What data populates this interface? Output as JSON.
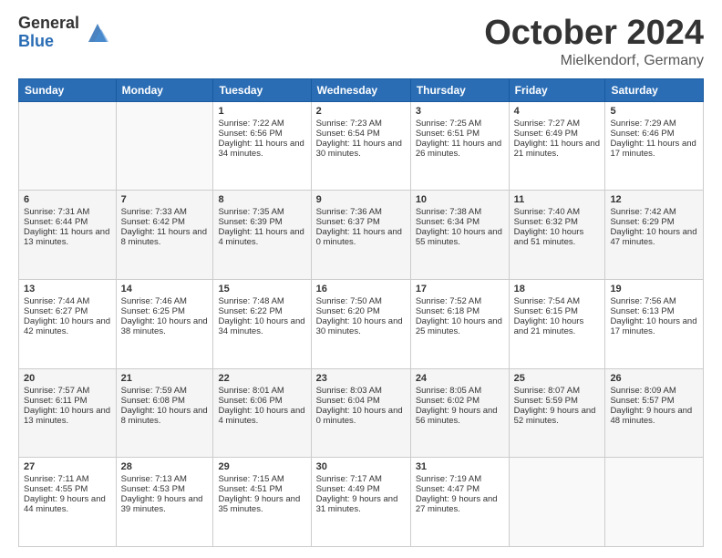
{
  "logo": {
    "general": "General",
    "blue": "Blue"
  },
  "header": {
    "month": "October 2024",
    "location": "Mielkendorf, Germany"
  },
  "weekdays": [
    "Sunday",
    "Monday",
    "Tuesday",
    "Wednesday",
    "Thursday",
    "Friday",
    "Saturday"
  ],
  "weeks": [
    [
      {
        "day": "",
        "sunrise": "",
        "sunset": "",
        "daylight": ""
      },
      {
        "day": "",
        "sunrise": "",
        "sunset": "",
        "daylight": ""
      },
      {
        "day": "1",
        "sunrise": "Sunrise: 7:22 AM",
        "sunset": "Sunset: 6:56 PM",
        "daylight": "Daylight: 11 hours and 34 minutes."
      },
      {
        "day": "2",
        "sunrise": "Sunrise: 7:23 AM",
        "sunset": "Sunset: 6:54 PM",
        "daylight": "Daylight: 11 hours and 30 minutes."
      },
      {
        "day": "3",
        "sunrise": "Sunrise: 7:25 AM",
        "sunset": "Sunset: 6:51 PM",
        "daylight": "Daylight: 11 hours and 26 minutes."
      },
      {
        "day": "4",
        "sunrise": "Sunrise: 7:27 AM",
        "sunset": "Sunset: 6:49 PM",
        "daylight": "Daylight: 11 hours and 21 minutes."
      },
      {
        "day": "5",
        "sunrise": "Sunrise: 7:29 AM",
        "sunset": "Sunset: 6:46 PM",
        "daylight": "Daylight: 11 hours and 17 minutes."
      }
    ],
    [
      {
        "day": "6",
        "sunrise": "Sunrise: 7:31 AM",
        "sunset": "Sunset: 6:44 PM",
        "daylight": "Daylight: 11 hours and 13 minutes."
      },
      {
        "day": "7",
        "sunrise": "Sunrise: 7:33 AM",
        "sunset": "Sunset: 6:42 PM",
        "daylight": "Daylight: 11 hours and 8 minutes."
      },
      {
        "day": "8",
        "sunrise": "Sunrise: 7:35 AM",
        "sunset": "Sunset: 6:39 PM",
        "daylight": "Daylight: 11 hours and 4 minutes."
      },
      {
        "day": "9",
        "sunrise": "Sunrise: 7:36 AM",
        "sunset": "Sunset: 6:37 PM",
        "daylight": "Daylight: 11 hours and 0 minutes."
      },
      {
        "day": "10",
        "sunrise": "Sunrise: 7:38 AM",
        "sunset": "Sunset: 6:34 PM",
        "daylight": "Daylight: 10 hours and 55 minutes."
      },
      {
        "day": "11",
        "sunrise": "Sunrise: 7:40 AM",
        "sunset": "Sunset: 6:32 PM",
        "daylight": "Daylight: 10 hours and 51 minutes."
      },
      {
        "day": "12",
        "sunrise": "Sunrise: 7:42 AM",
        "sunset": "Sunset: 6:29 PM",
        "daylight": "Daylight: 10 hours and 47 minutes."
      }
    ],
    [
      {
        "day": "13",
        "sunrise": "Sunrise: 7:44 AM",
        "sunset": "Sunset: 6:27 PM",
        "daylight": "Daylight: 10 hours and 42 minutes."
      },
      {
        "day": "14",
        "sunrise": "Sunrise: 7:46 AM",
        "sunset": "Sunset: 6:25 PM",
        "daylight": "Daylight: 10 hours and 38 minutes."
      },
      {
        "day": "15",
        "sunrise": "Sunrise: 7:48 AM",
        "sunset": "Sunset: 6:22 PM",
        "daylight": "Daylight: 10 hours and 34 minutes."
      },
      {
        "day": "16",
        "sunrise": "Sunrise: 7:50 AM",
        "sunset": "Sunset: 6:20 PM",
        "daylight": "Daylight: 10 hours and 30 minutes."
      },
      {
        "day": "17",
        "sunrise": "Sunrise: 7:52 AM",
        "sunset": "Sunset: 6:18 PM",
        "daylight": "Daylight: 10 hours and 25 minutes."
      },
      {
        "day": "18",
        "sunrise": "Sunrise: 7:54 AM",
        "sunset": "Sunset: 6:15 PM",
        "daylight": "Daylight: 10 hours and 21 minutes."
      },
      {
        "day": "19",
        "sunrise": "Sunrise: 7:56 AM",
        "sunset": "Sunset: 6:13 PM",
        "daylight": "Daylight: 10 hours and 17 minutes."
      }
    ],
    [
      {
        "day": "20",
        "sunrise": "Sunrise: 7:57 AM",
        "sunset": "Sunset: 6:11 PM",
        "daylight": "Daylight: 10 hours and 13 minutes."
      },
      {
        "day": "21",
        "sunrise": "Sunrise: 7:59 AM",
        "sunset": "Sunset: 6:08 PM",
        "daylight": "Daylight: 10 hours and 8 minutes."
      },
      {
        "day": "22",
        "sunrise": "Sunrise: 8:01 AM",
        "sunset": "Sunset: 6:06 PM",
        "daylight": "Daylight: 10 hours and 4 minutes."
      },
      {
        "day": "23",
        "sunrise": "Sunrise: 8:03 AM",
        "sunset": "Sunset: 6:04 PM",
        "daylight": "Daylight: 10 hours and 0 minutes."
      },
      {
        "day": "24",
        "sunrise": "Sunrise: 8:05 AM",
        "sunset": "Sunset: 6:02 PM",
        "daylight": "Daylight: 9 hours and 56 minutes."
      },
      {
        "day": "25",
        "sunrise": "Sunrise: 8:07 AM",
        "sunset": "Sunset: 5:59 PM",
        "daylight": "Daylight: 9 hours and 52 minutes."
      },
      {
        "day": "26",
        "sunrise": "Sunrise: 8:09 AM",
        "sunset": "Sunset: 5:57 PM",
        "daylight": "Daylight: 9 hours and 48 minutes."
      }
    ],
    [
      {
        "day": "27",
        "sunrise": "Sunrise: 7:11 AM",
        "sunset": "Sunset: 4:55 PM",
        "daylight": "Daylight: 9 hours and 44 minutes."
      },
      {
        "day": "28",
        "sunrise": "Sunrise: 7:13 AM",
        "sunset": "Sunset: 4:53 PM",
        "daylight": "Daylight: 9 hours and 39 minutes."
      },
      {
        "day": "29",
        "sunrise": "Sunrise: 7:15 AM",
        "sunset": "Sunset: 4:51 PM",
        "daylight": "Daylight: 9 hours and 35 minutes."
      },
      {
        "day": "30",
        "sunrise": "Sunrise: 7:17 AM",
        "sunset": "Sunset: 4:49 PM",
        "daylight": "Daylight: 9 hours and 31 minutes."
      },
      {
        "day": "31",
        "sunrise": "Sunrise: 7:19 AM",
        "sunset": "Sunset: 4:47 PM",
        "daylight": "Daylight: 9 hours and 27 minutes."
      },
      {
        "day": "",
        "sunrise": "",
        "sunset": "",
        "daylight": ""
      },
      {
        "day": "",
        "sunrise": "",
        "sunset": "",
        "daylight": ""
      }
    ]
  ]
}
